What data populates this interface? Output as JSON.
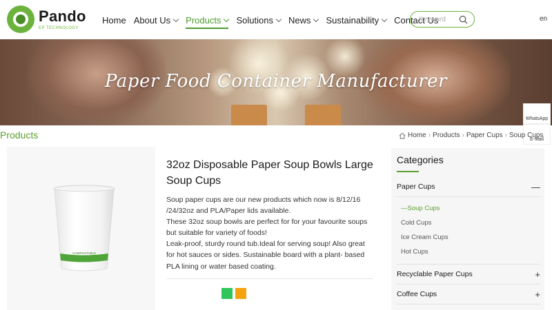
{
  "header": {
    "brand": "Pando",
    "brand_sub": "EP TECHNOLOGY",
    "nav": [
      {
        "label": "Home",
        "caret": false
      },
      {
        "label": "About Us",
        "caret": true
      },
      {
        "label": "Products",
        "caret": true,
        "active": true
      },
      {
        "label": "Solutions",
        "caret": true
      },
      {
        "label": "News",
        "caret": true
      },
      {
        "label": "Sustainability",
        "caret": true
      },
      {
        "label": "Contact Us",
        "caret": false
      }
    ],
    "search_placeholder": "Keyword",
    "language": "en"
  },
  "banner": {
    "title": "Paper Food Container Manufacturer"
  },
  "floating": {
    "whatsapp": "WhatsApp",
    "email": "E-Mail"
  },
  "breadcrumb": {
    "section": "Products",
    "items": [
      "Home",
      "Products",
      "Paper Cups",
      "Soup Cups"
    ]
  },
  "product": {
    "title": "32oz Disposable Paper Soup Bowls Large Soup Cups",
    "description": "Soup paper cups are our new products which now is 8/12/16 /24/32oz and PLA/Paper lids available.\nThese 32oz soup bowls are perfect for for your favourite soups but suitable for variety of foods!\nLeak-proof, sturdy round tub.Ideal for serving soup! Also great for hot sauces or sides. Sustainable board with a plant- based PLA lining or water based coating.",
    "cup_label": "COMPOSTABLE",
    "swatches": [
      "#2fc55b",
      "#f5a30c"
    ]
  },
  "categories": {
    "heading": "Categories",
    "groups": [
      {
        "label": "Paper Cups",
        "toggle": "—",
        "subs": [
          "Soup Cups",
          "Cold Cups",
          "Ice Cream Cups",
          "Hot Cups"
        ]
      },
      {
        "label": "Recyclable Paper Cups",
        "toggle": "+"
      },
      {
        "label": "Coffee Cups",
        "toggle": "+"
      }
    ],
    "active_sub_prefix": "—"
  }
}
